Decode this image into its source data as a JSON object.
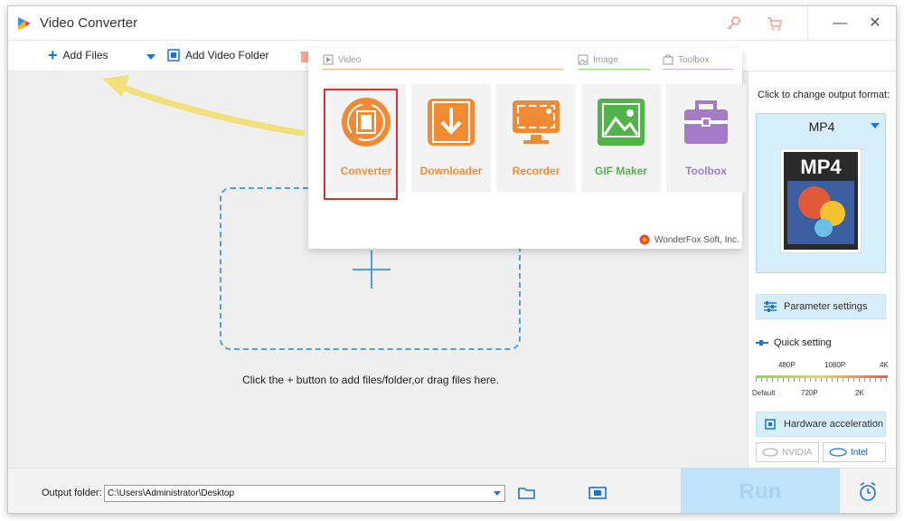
{
  "title": {
    "app_name": "Video Converter"
  },
  "toolbar": {
    "add_files": "Add Files",
    "add_video_folder": "Add Video Folder"
  },
  "workarea": {
    "hint": "Click the + button to add files/folder,or drag files here."
  },
  "popup": {
    "categories": {
      "video": "Video",
      "image": "Image",
      "toolbox": "Toolbox"
    },
    "tiles": [
      {
        "label": "Converter",
        "color": "#f08a33"
      },
      {
        "label": "Downloader",
        "color": "#f08a33"
      },
      {
        "label": "Recorder",
        "color": "#f08a33"
      },
      {
        "label": "GIF Maker",
        "color": "#52b34a"
      },
      {
        "label": "Toolbox",
        "color": "#a57bc7"
      }
    ],
    "brand": "WonderFox Soft, Inc."
  },
  "right_panel": {
    "change_format_label": "Click to change output format:",
    "format": "MP4",
    "format_thumb_text": "MP4",
    "parameter_settings": "Parameter settings",
    "quick_setting": "Quick setting",
    "slider_top": [
      "480P",
      "1080P",
      "4K"
    ],
    "slider_bottom": [
      "Default",
      "720P",
      "2K"
    ],
    "hardware_acceleration": "Hardware acceleration",
    "nvidia": "NVIDIA",
    "intel": "Intel"
  },
  "bottom": {
    "output_folder_label": "Output folder:",
    "output_folder_path": "C:\\Users\\Administrator\\Desktop",
    "run": "Run"
  },
  "colors": {
    "accent": "#1a73d9",
    "orange": "#f08a33",
    "highlight": "#d9312e"
  }
}
